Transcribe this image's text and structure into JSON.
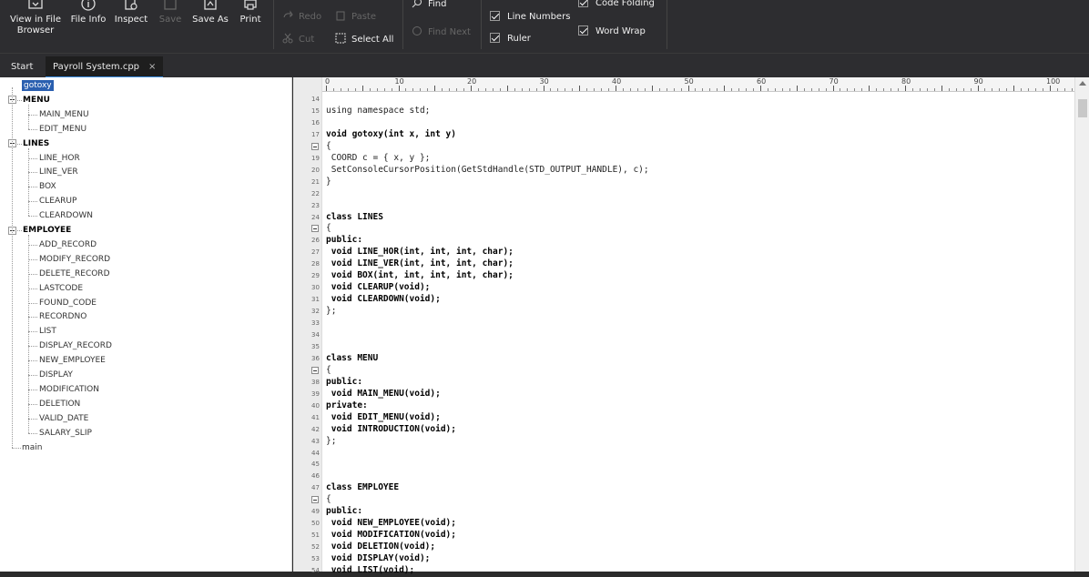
{
  "toolbar": {
    "file_group": [
      {
        "label": "View in File\nBrowser",
        "label1": "View in File",
        "label2": "Browser",
        "icon": "folder-icon",
        "enabled": true
      },
      {
        "label": "File Info",
        "icon": "info-icon",
        "enabled": true
      },
      {
        "label": "Inspect",
        "icon": "inspect-icon",
        "enabled": true
      },
      {
        "label": "Save",
        "icon": "save-icon",
        "enabled": false
      },
      {
        "label": "Save As",
        "icon": "save-as-icon",
        "enabled": true
      },
      {
        "label": "Print",
        "icon": "print-icon",
        "enabled": true
      }
    ],
    "edit_group": {
      "redo": "Redo",
      "paste": "Paste",
      "cut": "Cut",
      "select_all": "Select All"
    },
    "find_group": {
      "find": "Find",
      "find_next": "Find Next"
    },
    "view_group": {
      "line_numbers": "Line Numbers",
      "ruler": "Ruler",
      "code_folding": "Code Folding",
      "word_wrap": "Word Wrap"
    }
  },
  "tabs": [
    {
      "label": "Start",
      "active": false
    },
    {
      "label": "Payroll System.cpp",
      "active": true,
      "close": "×"
    }
  ],
  "tree": {
    "selected": "gotoxy",
    "groups": [
      {
        "name": "MENU",
        "children": [
          "MAIN_MENU",
          "EDIT_MENU"
        ]
      },
      {
        "name": "LINES",
        "children": [
          "LINE_HOR",
          "LINE_VER",
          "BOX",
          "CLEARUP",
          "CLEARDOWN"
        ]
      },
      {
        "name": "EMPLOYEE",
        "children": [
          "ADD_RECORD",
          "MODIFY_RECORD",
          "DELETE_RECORD",
          "LASTCODE",
          "FOUND_CODE",
          "RECORDNO",
          "LIST",
          "DISPLAY_RECORD",
          "NEW_EMPLOYEE",
          "DISPLAY",
          "MODIFICATION",
          "DELETION",
          "VALID_DATE",
          "SALARY_SLIP"
        ]
      }
    ],
    "tail": "main"
  },
  "ruler": {
    "labels": [
      "0",
      "10",
      "20",
      "30",
      "40",
      "50",
      "60",
      "70",
      "80",
      "90",
      "100"
    ]
  },
  "code_lines": [
    {
      "n": "14",
      "t": "",
      "kw": false,
      "fold": false
    },
    {
      "n": "15",
      "t": "using namespace std;",
      "kw": false,
      "fold": false
    },
    {
      "n": "16",
      "t": "",
      "kw": false,
      "fold": false
    },
    {
      "n": "17",
      "t": "void gotoxy(int x, int y)",
      "kw": true,
      "fold": false
    },
    {
      "n": "18",
      "t": "{",
      "kw": false,
      "fold": true
    },
    {
      "n": "19",
      "t": " COORD c = { x, y };",
      "kw": false,
      "fold": false
    },
    {
      "n": "20",
      "t": " SetConsoleCursorPosition(GetStdHandle(STD_OUTPUT_HANDLE), c);",
      "kw": false,
      "fold": false
    },
    {
      "n": "21",
      "t": "}",
      "kw": false,
      "fold": false
    },
    {
      "n": "22",
      "t": "",
      "kw": false,
      "fold": false
    },
    {
      "n": "23",
      "t": "",
      "kw": false,
      "fold": false
    },
    {
      "n": "24",
      "t": "class LINES",
      "kw": true,
      "fold": false
    },
    {
      "n": "25",
      "t": "{",
      "kw": false,
      "fold": true
    },
    {
      "n": "26",
      "t": "public:",
      "kw": true,
      "fold": false
    },
    {
      "n": "27",
      "t": " void LINE_HOR(int, int, int, char);",
      "kw": true,
      "fold": false
    },
    {
      "n": "28",
      "t": " void LINE_VER(int, int, int, char);",
      "kw": true,
      "fold": false
    },
    {
      "n": "29",
      "t": " void BOX(int, int, int, int, char);",
      "kw": true,
      "fold": false
    },
    {
      "n": "30",
      "t": " void CLEARUP(void);",
      "kw": true,
      "fold": false
    },
    {
      "n": "31",
      "t": " void CLEARDOWN(void);",
      "kw": true,
      "fold": false
    },
    {
      "n": "32",
      "t": "};",
      "kw": false,
      "fold": false
    },
    {
      "n": "33",
      "t": "",
      "kw": false,
      "fold": false
    },
    {
      "n": "34",
      "t": "",
      "kw": false,
      "fold": false
    },
    {
      "n": "35",
      "t": "",
      "kw": false,
      "fold": false
    },
    {
      "n": "36",
      "t": "class MENU",
      "kw": true,
      "fold": false
    },
    {
      "n": "37",
      "t": "{",
      "kw": false,
      "fold": true
    },
    {
      "n": "38",
      "t": "public:",
      "kw": true,
      "fold": false
    },
    {
      "n": "39",
      "t": " void MAIN_MENU(void);",
      "kw": true,
      "fold": false
    },
    {
      "n": "40",
      "t": "private:",
      "kw": true,
      "fold": false
    },
    {
      "n": "41",
      "t": " void EDIT_MENU(void);",
      "kw": true,
      "fold": false
    },
    {
      "n": "42",
      "t": " void INTRODUCTION(void);",
      "kw": true,
      "fold": false
    },
    {
      "n": "43",
      "t": "};",
      "kw": false,
      "fold": false
    },
    {
      "n": "44",
      "t": "",
      "kw": false,
      "fold": false
    },
    {
      "n": "45",
      "t": "",
      "kw": false,
      "fold": false
    },
    {
      "n": "46",
      "t": "",
      "kw": false,
      "fold": false
    },
    {
      "n": "47",
      "t": "class EMPLOYEE",
      "kw": true,
      "fold": false
    },
    {
      "n": "48",
      "t": "{",
      "kw": false,
      "fold": true
    },
    {
      "n": "49",
      "t": "public:",
      "kw": true,
      "fold": false
    },
    {
      "n": "50",
      "t": " void NEW_EMPLOYEE(void);",
      "kw": true,
      "fold": false
    },
    {
      "n": "51",
      "t": " void MODIFICATION(void);",
      "kw": true,
      "fold": false
    },
    {
      "n": "52",
      "t": " void DELETION(void);",
      "kw": true,
      "fold": false
    },
    {
      "n": "53",
      "t": " void DISPLAY(void);",
      "kw": true,
      "fold": false
    },
    {
      "n": "54",
      "t": " void LIST(void);",
      "kw": true,
      "fold": false
    }
  ]
}
